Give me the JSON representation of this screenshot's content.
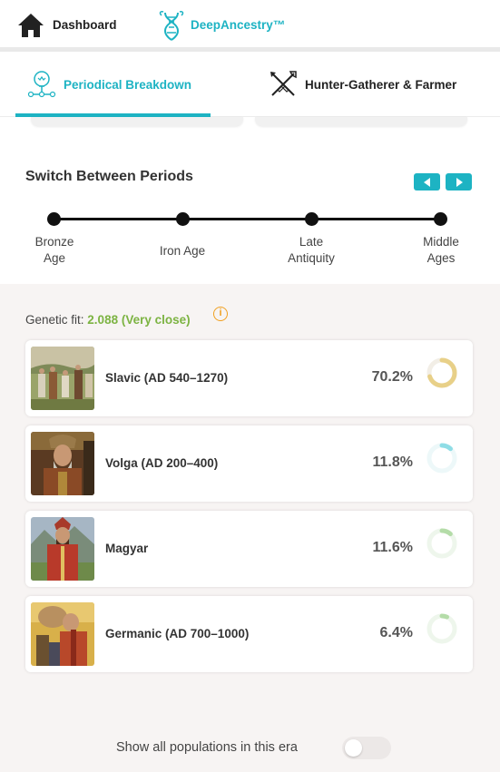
{
  "topnav": {
    "dashboard_label": "Dashboard",
    "deep_label": "DeepAncestry™"
  },
  "subnav": {
    "periodical_label": "Periodical Breakdown",
    "hunter_label": "Hunter-Gatherer & Farmer"
  },
  "periods": {
    "title": "Switch Between Periods",
    "items": [
      {
        "line1": "Bronze",
        "line2": "Age"
      },
      {
        "line1": "Iron Age",
        "line2": ""
      },
      {
        "line1": "Late",
        "line2": "Antiquity"
      },
      {
        "line1": "Middle",
        "line2": "Ages"
      }
    ]
  },
  "fit": {
    "label": "Genetic fit:",
    "value": "2.088 (Very close)"
  },
  "populations": [
    {
      "name": "Slavic (AD 540–1270)",
      "percent": "70.2%",
      "fraction": 0.702,
      "color": "#e8d088"
    },
    {
      "name": "Volga (AD 200–400)",
      "percent": "11.8%",
      "fraction": 0.118,
      "color": "#8fdde6"
    },
    {
      "name": "Magyar",
      "percent": "11.6%",
      "fraction": 0.116,
      "color": "#b4dca8"
    },
    {
      "name": "Germanic (AD 700–1000)",
      "percent": "6.4%",
      "fraction": 0.064,
      "color": "#b4dca8"
    }
  ],
  "toggle": {
    "label": "Show all populations in this era"
  },
  "colors": {
    "accent": "#1db3c3",
    "fit_green": "#7cb342",
    "info_orange": "#f0a020"
  }
}
